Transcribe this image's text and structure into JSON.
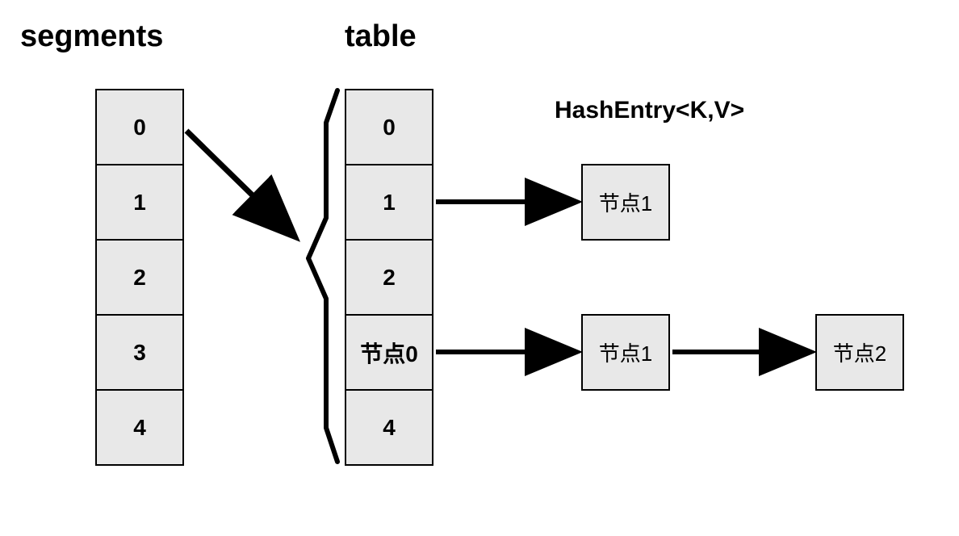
{
  "titles": {
    "segments": "segments",
    "table": "table"
  },
  "entry_label": "HashEntry<K,V>",
  "segments": {
    "cells": [
      "0",
      "1",
      "2",
      "3",
      "4"
    ]
  },
  "table": {
    "cells": [
      "0",
      "1",
      "2",
      "节点0",
      "4"
    ]
  },
  "nodes": {
    "row1_node1": "节点1",
    "row3_node1": "节点1",
    "row3_node2": "节点2"
  }
}
